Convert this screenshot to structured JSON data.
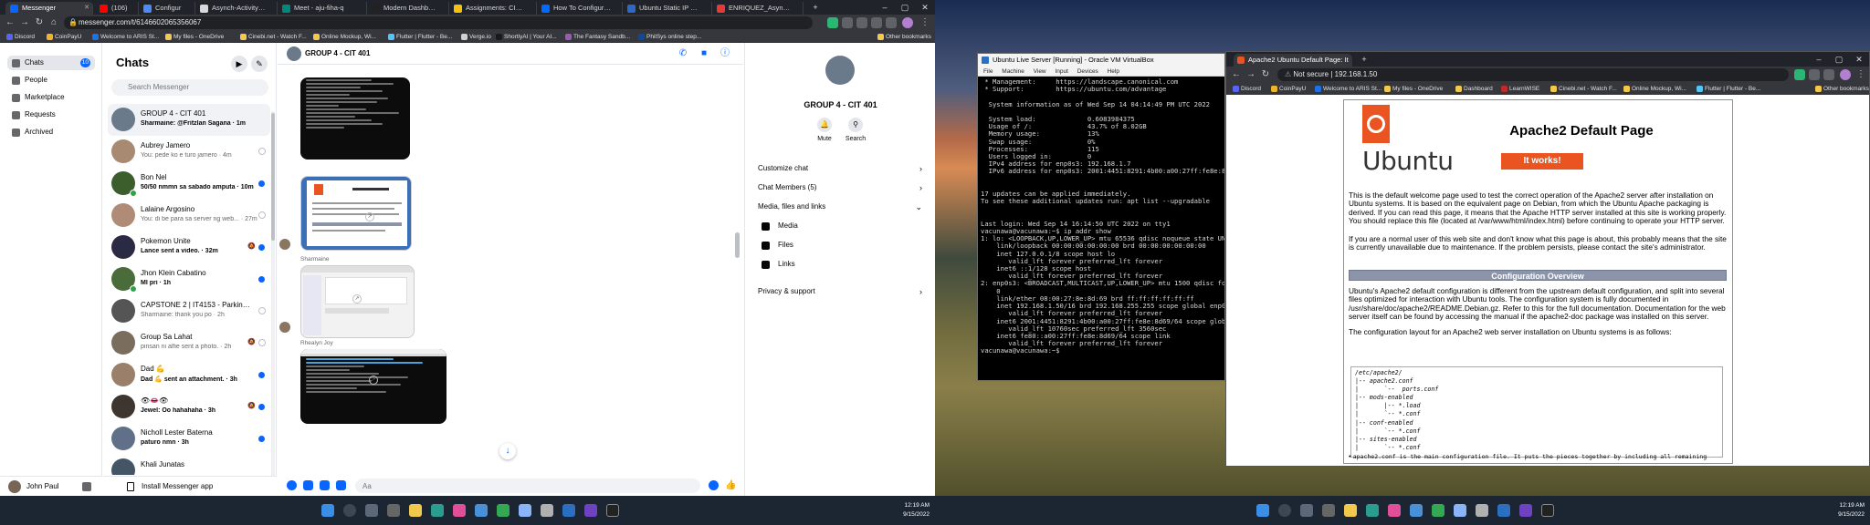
{
  "left_browser": {
    "tabs": [
      {
        "label": "Messenger",
        "color": "#0866ff"
      },
      {
        "label": "(106)",
        "color": "#ff0000"
      },
      {
        "label": "Configur",
        "color": "#4b8bf5"
      },
      {
        "label": "Asynch-Activity-Static",
        "color": "#d8d8d8"
      },
      {
        "label": "Meet - aju-fiha-q",
        "color": "#00897b"
      },
      {
        "label": "Modern Dashboard U",
        "color": "#222"
      },
      {
        "label": "Assignments: CIT 401",
        "color": "#f4c20d"
      },
      {
        "label": "How To Configure Stat",
        "color": "#0069ff"
      },
      {
        "label": "Ubuntu Static IP confi",
        "color": "#2d68c4"
      },
      {
        "label": "ENRIQUEZ_Asynch-Ac",
        "color": "#e53935"
      }
    ],
    "url": "messenger.com/t/6146602065356067",
    "bookmarks": [
      "Discord",
      "CoinPayU",
      "Welcome to ARIS St...",
      "My files - OneDrive",
      "Cinebi.net - Watch F...",
      "Online Mockup, Wi...",
      "Flutter | Flutter - Be...",
      "Verge.io",
      "ShortlyAI | Your AI...",
      "The Fantasy Sandb...",
      "PhilSys online step..."
    ],
    "other_bookmarks": "Other bookmarks"
  },
  "messenger": {
    "rail": [
      {
        "label": "Chats",
        "badge": "10"
      },
      {
        "label": "People"
      },
      {
        "label": "Marketplace"
      },
      {
        "label": "Requests"
      },
      {
        "label": "Archived"
      }
    ],
    "user_name": "John Paul",
    "chats_title": "Chats",
    "search_placeholder": "Search Messenger",
    "install_label": "Install Messenger app",
    "conversations": [
      {
        "name": "GROUP 4 - CIT 401",
        "preview": "Sharmaine: @Fritzlan Sagana · 1m",
        "color": "#6b7a8a",
        "state": "unread"
      },
      {
        "name": "Aubrey Jamero",
        "preview": "You: pede ko e turo jamero · 4m",
        "color": "#a88a72",
        "state": "seen"
      },
      {
        "name": "Bon Nel",
        "preview": "50/50 nmmn sa sabado amputa · 10m",
        "color": "#3b5e2c",
        "state": "unread",
        "online": true
      },
      {
        "name": "Lalaine Argosino",
        "preview": "You: di be para sa server ng web... · 27m",
        "color": "#b08c78",
        "state": "seen"
      },
      {
        "name": "Pokemon Unite",
        "preview": "Lance sent a video. · 32m",
        "color": "#2a2a44",
        "state": "muted"
      },
      {
        "name": "Jhon Klein Cabatino",
        "preview": "MI pri · 1h",
        "color": "#4a6c3a",
        "state": "unread",
        "online": true
      },
      {
        "name": "CAPSTONE 2 | IT4153 - Parking S...",
        "preview": "Sharmaine: thank you po · 2h",
        "color": "#555",
        "state": "seen"
      },
      {
        "name": "Group Sa Lahat",
        "preview": "pinsan ni alfie sent a photo. · 2h",
        "color": "#7b6d5d",
        "state": "muted"
      },
      {
        "name": "Dad 💪",
        "preview": "Dad 💪 sent an attachment. · 3h",
        "color": "#9a7f6a",
        "state": "unread"
      },
      {
        "name": "👁👄👁",
        "preview": "Jewel: Oo hahahaha · 3h",
        "color": "#3d3530",
        "state": "muted"
      },
      {
        "name": "Nicholl Lester Baterna",
        "preview": "paturo nmn · 3h",
        "color": "#607088",
        "state": "unread"
      },
      {
        "name": "Khali Junatas",
        "preview": "",
        "color": "#445566",
        "state": "none"
      }
    ],
    "thread": {
      "title": "GROUP 4 - CIT 401",
      "senders": [
        "Sharmaine",
        "Rhealyn Joy"
      ],
      "composer_placeholder": "Aa"
    },
    "info": {
      "title": "GROUP 4 - CIT 401",
      "actions": [
        "Mute",
        "Search"
      ],
      "rows": [
        "Customize chat",
        "Chat Members (5)",
        "Media, files and links"
      ],
      "sub_rows": [
        "Media",
        "Files",
        "Links"
      ],
      "privacy": "Privacy & support"
    }
  },
  "taskbar": {
    "left_time": "12:19 AM",
    "left_date": "9/15/2022",
    "right_time": "12:19 AM",
    "right_date": "9/15/2022"
  },
  "vbox": {
    "title": "Ubuntu Live Server [Running] - Oracle VM VirtualBox",
    "menu": "File Machine View Input Devices Help",
    "terminal": [
      " * Management:     https://landscape.canonical.com",
      " * Support:        https://ubuntu.com/advantage",
      "",
      "  System information as of Wed Sep 14 04:14:49 PM UTC 2022",
      "",
      "  System load:             0.6083984375",
      "  Usage of /:              43.7% of 8.02GB",
      "  Memory usage:            13%",
      "  Swap usage:              0%",
      "  Processes:               115",
      "  Users logged in:         0",
      "  IPv4 address for enp0s3: 192.168.1.7",
      "  IPv6 address for enp0s3: 2001:4451:8291:4b00:a00:27ff:fe8e:8d69",
      "",
      "",
      "17 updates can be applied immediately.",
      "To see these additional updates run: apt list --upgradable",
      "",
      "",
      "Last login: Wed Sep 14 16:14:50 UTC 2022 on tty1",
      "vacunawa@vacunawa:~$ ip addr show",
      "1: lo: <LOOPBACK,UP,LOWER_UP> mtu 65536 qdisc noqueue state UNKNOWN",
      "    link/loopback 00:00:00:00:00:00 brd 00:00:00:00:00:00",
      "    inet 127.0.0.1/8 scope host lo",
      "       valid_lft forever preferred_lft forever",
      "    inet6 ::1/128 scope host",
      "       valid_lft forever preferred_lft forever",
      "2: enp0s3: <BROADCAST,MULTICAST,UP,LOWER_UP> mtu 1500 qdisc fq_codel",
      "    0",
      "    link/ether 08:00:27:8e:8d:69 brd ff:ff:ff:ff:ff:ff",
      "    inet 192.168.1.50/16 brd 192.168.255.255 scope global enp0s3",
      "       valid_lft forever preferred_lft forever",
      "    inet6 2001:4451:8291:4b00:a00:27ff:fe8e:8d69/64 scope global",
      "       valid_lft 10760sec preferred_lft 3560sec",
      "    inet6 fe80::a00:27ff:fe8e:8d69/64 scope link",
      "       valid_lft forever preferred_lft forever",
      "vacunawa@vacunawa:~$"
    ]
  },
  "right_browser": {
    "tab": "Apache2 Ubuntu Default Page: It",
    "url": "Not secure | 192.168.1.50",
    "bookmarks": [
      "Discord",
      "CoinPayU",
      "Welcome to ARIS St...",
      "My files - OneDrive",
      "Dashboard",
      "LearnWISE",
      "Cinebi.net - Watch F...",
      "Online Mockup, Wi...",
      "Flutter | Flutter - Be..."
    ],
    "other_bookmarks": "Other bookmarks"
  },
  "apache": {
    "logo": "Ubuntu",
    "title": "Apache2 Default Page",
    "works": "It works!",
    "p1": "This is the default welcome page used to test the correct operation of the Apache2 server after installation on Ubuntu systems. It is based on the equivalent page on Debian, from which the Ubuntu Apache packaging is derived. If you can read this page, it means that the Apache HTTP server installed at this site is working properly. You should replace this file (located at /var/www/html/index.html) before continuing to operate your HTTP server.",
    "p2": "If you are a normal user of this web site and don't know what this page is about, this probably means that the site is currently unavailable due to maintenance. If the problem persists, please contact the site's administrator.",
    "section": "Configuration Overview",
    "p3": "Ubuntu's Apache2 default configuration is different from the upstream default configuration, and split into several files optimized for interaction with Ubuntu tools. The configuration system is fully documented in /usr/share/doc/apache2/README.Debian.gz. Refer to this for the full documentation. Documentation for the web server itself can be found by accessing the manual if the apache2-doc package was installed on this server.",
    "p4": "The configuration layout for an Apache2 web server installation on Ubuntu systems is as follows:",
    "tree": [
      "/etc/apache2/",
      "|-- apache2.conf",
      "|       `--  ports.conf",
      "|-- mods-enabled",
      "|       |-- *.load",
      "|       `-- *.conf",
      "|-- conf-enabled",
      "|       `-- *.conf",
      "|-- sites-enabled",
      "|       `-- *.conf"
    ],
    "bullet": "apache2.conf is the main configuration file. It puts the pieces together by including all remaining"
  }
}
